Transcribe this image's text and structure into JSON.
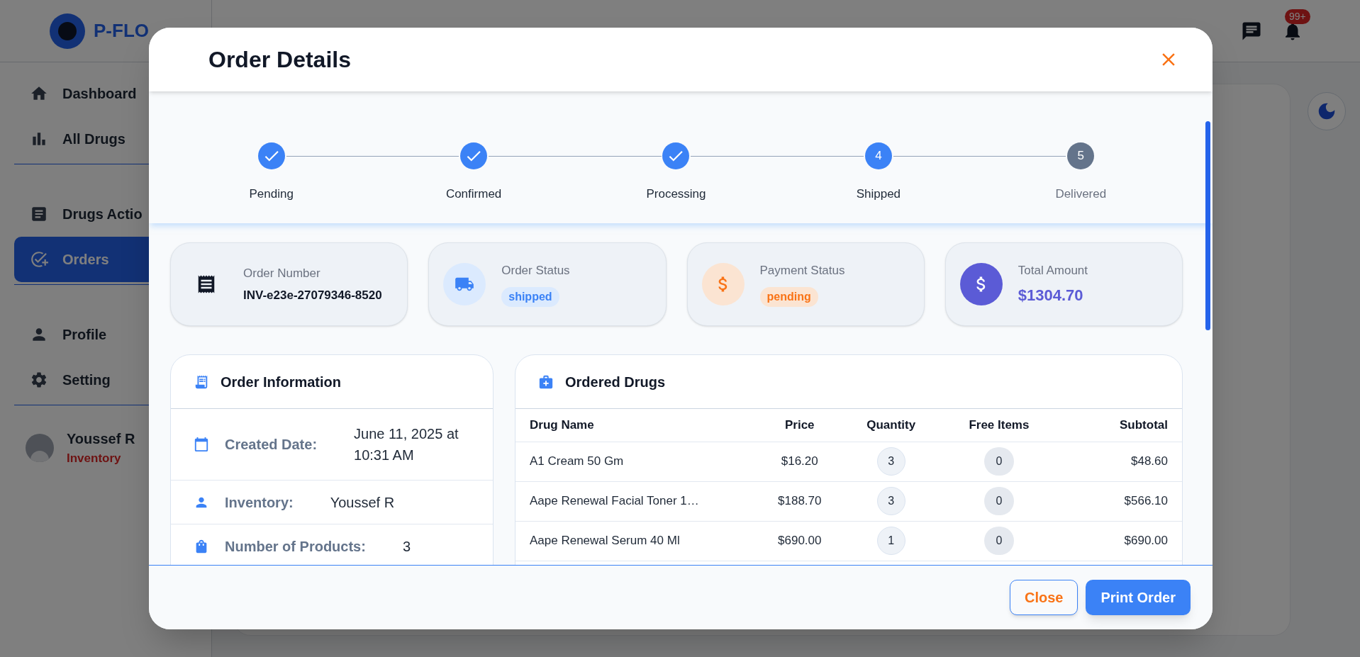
{
  "brand": {
    "name": "P-FLO"
  },
  "sidebar": {
    "groups": [
      {
        "items": [
          {
            "label": "Dashboard",
            "selected": false
          },
          {
            "label": "All Drugs",
            "selected": false
          }
        ]
      },
      {
        "items": [
          {
            "label": "Drugs Actio",
            "selected": false
          },
          {
            "label": "Orders",
            "selected": true
          }
        ]
      },
      {
        "items": [
          {
            "label": "Profile",
            "selected": false
          },
          {
            "label": "Setting",
            "selected": false
          }
        ]
      }
    ],
    "user": {
      "name": "Youssef R",
      "role": "Inventory"
    }
  },
  "header": {
    "notifications_badge": "99+"
  },
  "modal": {
    "title": "Order Details",
    "steps": [
      {
        "label": "Pending",
        "completed": true
      },
      {
        "label": "Confirmed",
        "completed": true
      },
      {
        "label": "Processing",
        "completed": true
      },
      {
        "label": "Shipped",
        "completed": false,
        "active": true,
        "number": "4"
      },
      {
        "label": "Delivered",
        "completed": false,
        "active": false,
        "number": "5"
      }
    ],
    "summary_cards": [
      {
        "kind": "number",
        "label": "Order Number",
        "value": "INV-e23e-27079346-8520"
      },
      {
        "kind": "shipping",
        "label": "Order Status",
        "value": "shipped"
      },
      {
        "kind": "payment",
        "label": "Payment Status",
        "value": "pending"
      },
      {
        "kind": "amount",
        "label": "Total Amount",
        "value": "$1304.70"
      }
    ],
    "order_information": {
      "title": "Order Information",
      "rows": [
        {
          "label": "Created Date:",
          "value": "June 11, 2025 at 10:31 AM"
        },
        {
          "label": "Inventory:",
          "value": "Youssef R"
        },
        {
          "label": "Number of Products:",
          "value": "3"
        }
      ]
    },
    "ordered_drugs": {
      "title": "Ordered Drugs",
      "columns": [
        "Drug Name",
        "Price",
        "Quantity",
        "Free Items",
        "Subtotal"
      ],
      "rows": [
        {
          "name": "A1 Cream 50 Gm",
          "price": "$16.20",
          "quantity": "3",
          "free_items": "0",
          "subtotal": "$48.60"
        },
        {
          "name": "Aape Renewal Facial Toner 1…",
          "price": "$188.70",
          "quantity": "3",
          "free_items": "0",
          "subtotal": "$566.10"
        },
        {
          "name": "Aape Renewal Serum 40 Ml",
          "price": "$690.00",
          "quantity": "1",
          "free_items": "0",
          "subtotal": "$690.00"
        }
      ]
    },
    "buttons": [
      {
        "label": "Close",
        "kind": "outline"
      },
      {
        "label": "Print Order",
        "kind": "primary"
      }
    ]
  }
}
